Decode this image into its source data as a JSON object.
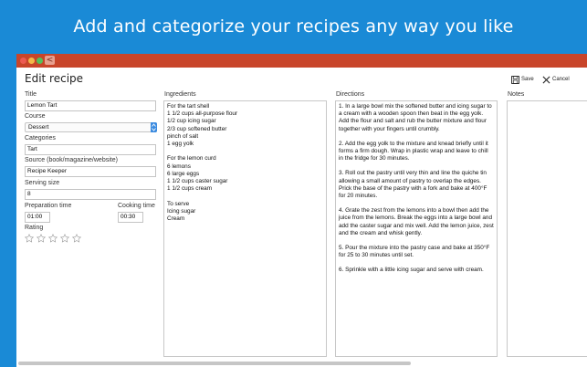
{
  "headline": "Add and categorize your recipes any way you like",
  "window": {
    "page_title": "Edit recipe",
    "back_glyph": "<",
    "toolbar": {
      "save_label": "Save",
      "cancel_label": "Cancel"
    }
  },
  "form": {
    "title_label": "Title",
    "title_value": "Lemon Tart",
    "course_label": "Course",
    "course_value": "Dessert",
    "categories_label": "Categories",
    "categories_value": "Tart",
    "source_label": "Source (book/magazine/website)",
    "source_value": "Recipe Keeper",
    "serving_label": "Serving size",
    "serving_value": "8",
    "prep_label": "Preparation time",
    "prep_value": "01:00",
    "cook_label": "Cooking time",
    "cook_value": "00:30",
    "rating_label": "Rating",
    "rating_value": 0,
    "rating_max": 5
  },
  "ingredients": {
    "label": "Ingredients",
    "lines": [
      "For the tart shell",
      "1 1/2 cups all-purpose flour",
      "1/2 cup icing sugar",
      "2/3 cup softened butter",
      "pinch of salt",
      "1 egg yolk",
      "",
      "For the lemon curd",
      "6 lemons",
      "6 large eggs",
      "1 1/2 cups caster sugar",
      "1 1/2 cups cream",
      "",
      "To serve",
      "Icing sugar",
      "Cream"
    ]
  },
  "directions": {
    "label": "Directions",
    "steps": [
      "1. In a large bowl mix the softened butter and icing sugar to a cream with a wooden spoon then beat in the egg yolk. Add the flour and salt and rub the butter mixture and flour together with your fingers until crumbly.",
      "2. Add the egg yolk to the mixture and knead briefly until it forms a firm dough. Wrap in plastic wrap and leave to chill in the fridge for 30 minutes.",
      "3. Roll out the pastry until very thin and line the quiche tin allowing a small amount of pastry to overlap the edges. Prick the base of the pastry with a fork and bake at 400°F for 20 minutes.",
      "4. Grate the zest from the lemons into a bowl then add the juice from the lemons. Break the eggs into a large bowl and add the caster sugar and mix well. Add the lemon juice, zest and the cream and whisk gently.",
      "5. Pour the mixture into the pastry case and bake at 350°F for 25 to 30 minutes until set.",
      "6. Sprinkle with a little icing sugar and serve with cream."
    ]
  },
  "notes": {
    "label": "Notes",
    "value": ""
  },
  "colors": {
    "background": "#1a8ad6",
    "titlebar": "#c8452a",
    "accent": "#3b8be0"
  }
}
